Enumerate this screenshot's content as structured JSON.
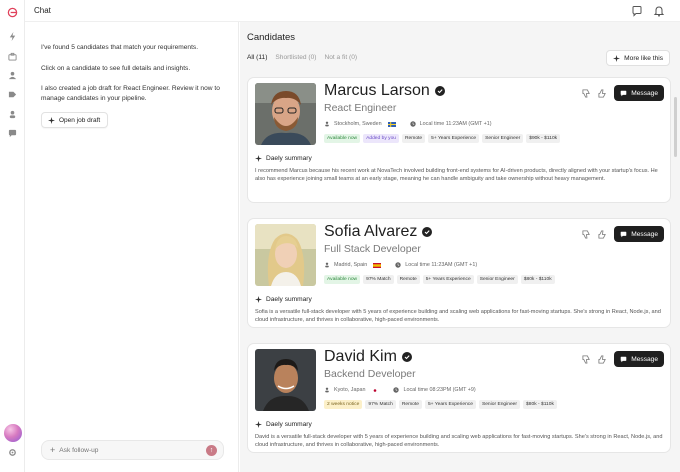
{
  "topbar": {
    "title": "Chat"
  },
  "rail": {
    "icons": [
      "bolt-icon",
      "briefcase-icon",
      "users-icon",
      "tag-icon",
      "user-icon",
      "chat-bubble-icon"
    ],
    "bottom": [
      "settings-icon"
    ]
  },
  "chat": {
    "messages": [
      "I've found 5 candidates that match your requirements.",
      "Click on a candidate to see full details and insights.",
      "I also created a job draft for React Engineer. Review it now to manage candidates in your pipeline."
    ],
    "open_draft_label": "Open job draft",
    "followup_placeholder": "Ask follow-up"
  },
  "candidates_panel": {
    "heading": "Candidates",
    "tabs": [
      {
        "label": "All (11)",
        "active": true
      },
      {
        "label": "Shortlisted (0)",
        "active": false
      },
      {
        "label": "Not a fit (0)",
        "active": false
      }
    ],
    "more_like_this": "More like this",
    "message_label": "Message",
    "summary_label": "Daely summary"
  },
  "candidates": [
    {
      "name": "Marcus Larson",
      "role": "React Engineer",
      "location": "Stockholm, Sweden",
      "local_time": "Local time 11:23AM (GMT +1)",
      "tags": [
        {
          "label": "Available now",
          "style": "green"
        },
        {
          "label": "Added by you",
          "style": "purple"
        },
        {
          "label": "Remote",
          "style": "gray"
        },
        {
          "label": "5+ Years Experience",
          "style": "gray"
        },
        {
          "label": "Senior Engineer",
          "style": "gray"
        },
        {
          "label": "$90k - $110k",
          "style": "gray"
        }
      ],
      "summary": "I recommend Marcus because his recent work at NovaTech involved building front-end systems for AI-driven products, directly aligned with your startup's focus. He also has experience joining small teams at an early stage, meaning he can handle ambiguity and take ownership without heavy management."
    },
    {
      "name": "Sofia Alvarez",
      "role": "Full Stack Developer",
      "location": "Madrid, Spain",
      "local_time": "Local time 11:23AM (GMT +1)",
      "tags": [
        {
          "label": "Available now",
          "style": "green"
        },
        {
          "label": "97% Match",
          "style": "gray"
        },
        {
          "label": "Remote",
          "style": "gray"
        },
        {
          "label": "5+ Years Experience",
          "style": "gray"
        },
        {
          "label": "Senior Engineer",
          "style": "gray"
        },
        {
          "label": "$80k - $110k",
          "style": "gray"
        }
      ],
      "summary": "Sofia is a versatile full-stack developer with 5 years of experience building and scaling web applications for fast-moving startups. She's strong in React, Node.js, and cloud infrastructure, and thrives in collaborative, high-paced environments."
    },
    {
      "name": "David Kim",
      "role": "Backend Developer",
      "location": "Kyoto, Japan",
      "local_time": "Local time 08:23PM (GMT +9)",
      "tags": [
        {
          "label": "2 weeks notice",
          "style": "yellow"
        },
        {
          "label": "97% Match",
          "style": "gray"
        },
        {
          "label": "Remote",
          "style": "gray"
        },
        {
          "label": "5+ Years Experience",
          "style": "gray"
        },
        {
          "label": "Senior Engineer",
          "style": "gray"
        },
        {
          "label": "$80k - $110k",
          "style": "gray"
        }
      ],
      "summary": "David is a versatile full-stack developer with 5 years of experience building and scaling web applications for fast-moving startups. She's strong in React, Node.js, and cloud infrastructure, and thrives in collaborative, high-paced environments."
    }
  ],
  "colors": {
    "accent": "#e0405a",
    "button_dark": "#1f1f1f",
    "panel_bg": "#f5f5f5"
  }
}
